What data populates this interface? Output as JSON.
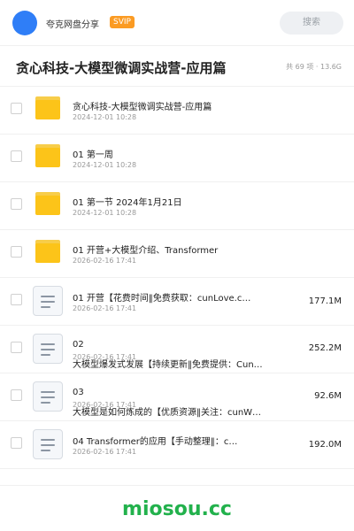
{
  "header": {
    "username": "夸克网盘分享",
    "badge": "SVIP",
    "search_placeholder": "搜索"
  },
  "folder": {
    "title": "贪心科技-大模型微调实战营-应用篇",
    "meta": "共 69 项 · 13.6G"
  },
  "files": [
    {
      "type": "folder",
      "name": "贪心科技-大模型微调实战营-应用篇",
      "date": "2024-12-01 10:28",
      "size": ""
    },
    {
      "type": "folder",
      "name": "01 第一周",
      "date": "2024-12-01 10:28",
      "size": ""
    },
    {
      "type": "folder",
      "name": "01 第一节 2024年1月21日",
      "date": "2024-12-01 10:28",
      "size": ""
    },
    {
      "type": "folder",
      "name": "01 开营+大模型介绍、Transformer",
      "date": "2026-02-16 17:41",
      "size": ""
    },
    {
      "type": "file",
      "name": "01 开营【花费时间‖免费获取：cunLove.c…",
      "date": "2026-02-16 17:41",
      "size": "177.1M"
    },
    {
      "type": "file",
      "name": "02",
      "name2": "大模型爆发式发展【持续更新‖免费提供：Cun…",
      "date": "2026-02-16 17:41",
      "size": "252.2M"
    },
    {
      "type": "file",
      "name": "03",
      "name2": "大模型是如何炼成的【优质资源‖关注：cunW…",
      "date": "2026-02-16 17:41",
      "size": "92.6M"
    },
    {
      "type": "file",
      "name": "04 Transformer的应用【手动整理‖：c…",
      "date": "2026-02-16 17:41",
      "size": "192.0M"
    }
  ],
  "footer": {
    "brand": "miosou.cc"
  },
  "colors": {
    "accent": "#2f7ef7",
    "svip": "#fb9b23",
    "folder": "#fcc419",
    "brand": "#22b14c"
  }
}
